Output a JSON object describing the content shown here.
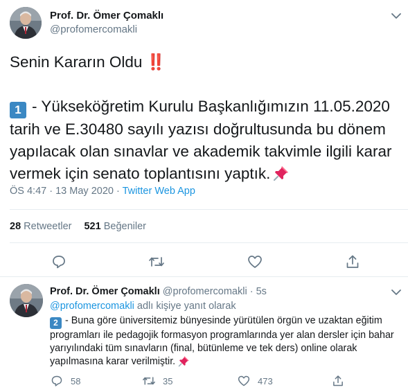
{
  "main_tweet": {
    "author_name": "Prof. Dr. Ömer Çomaklı",
    "author_handle": "@profomercomakli",
    "title_line": "Senin Kararın Oldu",
    "title_emoji": "‼️",
    "item_number": "1",
    "body": "- Yükseköğretim Kurulu Başkanlığımızın 11.05.2020 tarih ve E.30480 sayılı yazısı doğrultusunda bu dönem yapılacak olan sınavlar ve akademik takvimle ilgili karar vermek için senato toplantısını yaptık.",
    "time": "ÖS 4:47",
    "separator": "·",
    "date": "13 May 2020",
    "source": "Twitter Web App",
    "retweet_count": "28",
    "retweet_label": "Retweetler",
    "like_count": "521",
    "like_label": "Beğeniler"
  },
  "reply_tweet": {
    "author_name": "Prof. Dr. Ömer Çomaklı",
    "author_handle": "@profomercomakli",
    "separator": "·",
    "time_ago": "5s",
    "reply_mention": "@profomercomakli",
    "reply_suffix": "adlı kişiye yanıt olarak",
    "item_number": "2",
    "body": "- Buna göre üniversitemiz bünyesinde yürütülen örgün ve uzaktan eğitim programları ile pedagojik formasyon programlarında yer alan dersler için bahar yarıyılındaki tüm sınavların (final, bütünleme ve tek ders) online olarak yapılmasına karar verilmiştir.",
    "reply_count": "58",
    "retweet_count": "35",
    "like_count": "473"
  },
  "icons": {
    "reply": "reply-icon",
    "retweet": "retweet-icon",
    "like": "heart-icon",
    "share": "share-icon",
    "menu": "chevron-down-icon",
    "pin": "pushpin-icon"
  },
  "colors": {
    "text": "#14171a",
    "secondary": "#657786",
    "link": "#1b95e0",
    "keycap": "#3b88c3",
    "emoji_red": "#e0245e",
    "divider": "#e6ecf0"
  }
}
